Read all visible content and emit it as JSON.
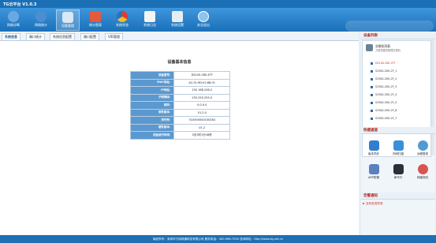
{
  "app": {
    "title": "TG云平台 V1.0.3"
  },
  "toolbar": {
    "items": [
      {
        "label": "网络诊断",
        "icon": "network-diagnosis-icon",
        "color": "#6aa8e4"
      },
      {
        "label": "网络统计",
        "icon": "network-stats-icon",
        "color": "#4d8ed0"
      },
      {
        "label": "设备管理",
        "icon": "device-management-icon",
        "color": "#d8e8f6"
      },
      {
        "label": "统计图表",
        "icon": "stats-chart-icon",
        "color": "#e55a3a"
      },
      {
        "label": "系统状态",
        "icon": "system-status-icon",
        "color": "#f0c020"
      },
      {
        "label": "系统日志",
        "icon": "system-log-icon",
        "color": "#f4f4f4"
      },
      {
        "label": "系统设置",
        "icon": "system-settings-icon",
        "color": "#e6eef5"
      },
      {
        "label": "安全退出",
        "icon": "logout-icon",
        "color": "#8ec3ee"
      }
    ]
  },
  "tabs": [
    "系统信息",
    "端口统计",
    "系统信息配置",
    "端口配置",
    "VID管理"
  ],
  "main": {
    "title": "设备基本信息",
    "rows": [
      {
        "key": "设备型号：",
        "value": "DS100-280-4TF"
      },
      {
        "key": "MAC地址：",
        "value": "AC:31:9D:01:6B:31"
      },
      {
        "key": "IP地址：",
        "value": "192.168.246.2"
      },
      {
        "key": "子网掩码：",
        "value": "255.255.255.0"
      },
      {
        "key": "网关：",
        "value": "0.0.0.0"
      },
      {
        "key": "软件版本：",
        "value": "V1.2.0"
      },
      {
        "key": "序列号：",
        "value": "310000000100284"
      },
      {
        "key": "硬件版本：",
        "value": "V1.2"
      },
      {
        "key": "设备运行时间：",
        "value": "0天3时1分18秒"
      }
    ]
  },
  "side": {
    "device_list_title": "设备列表",
    "device_header_line1": "交换机列表",
    "device_header_line2": "方便快捷的管理交换机",
    "devices": [
      "DS100-280-4TF",
      "S2300-28G-2F_1",
      "S2300-28G-2F_2",
      "S2300-28G-2F_3",
      "S2300-28G-2F_4",
      "S2300-28G-2F_5",
      "S2300-28G-2F_6",
      "S2300-28G-2F_7"
    ],
    "quicklinks_title": "快捷通道",
    "quicklinks": [
      {
        "label": "版本同步",
        "icon": "version-sync-icon",
        "color": "#2f7fd1"
      },
      {
        "label": "内网扫描",
        "icon": "lan-scan-icon",
        "color": "#3a8fd8"
      },
      {
        "label": "远程登录",
        "icon": "remote-login-icon",
        "color": "#4e9bd6"
      },
      {
        "label": "ARP防御",
        "icon": "arp-defense-icon",
        "color": "#5c7fbf"
      },
      {
        "label": "命令行",
        "icon": "command-line-icon",
        "color": "#2b2f3a"
      },
      {
        "label": "网速测试",
        "icon": "speed-test-icon",
        "color": "#d9534f"
      }
    ],
    "alert_title": "告警通知",
    "alert_text": "没有发现异常"
  },
  "footer": {
    "text": "版权所有：深圳市万纬网通科技有限公司 服务电话：400-966-7000 技术网址：http://www.tg-net.cn"
  }
}
